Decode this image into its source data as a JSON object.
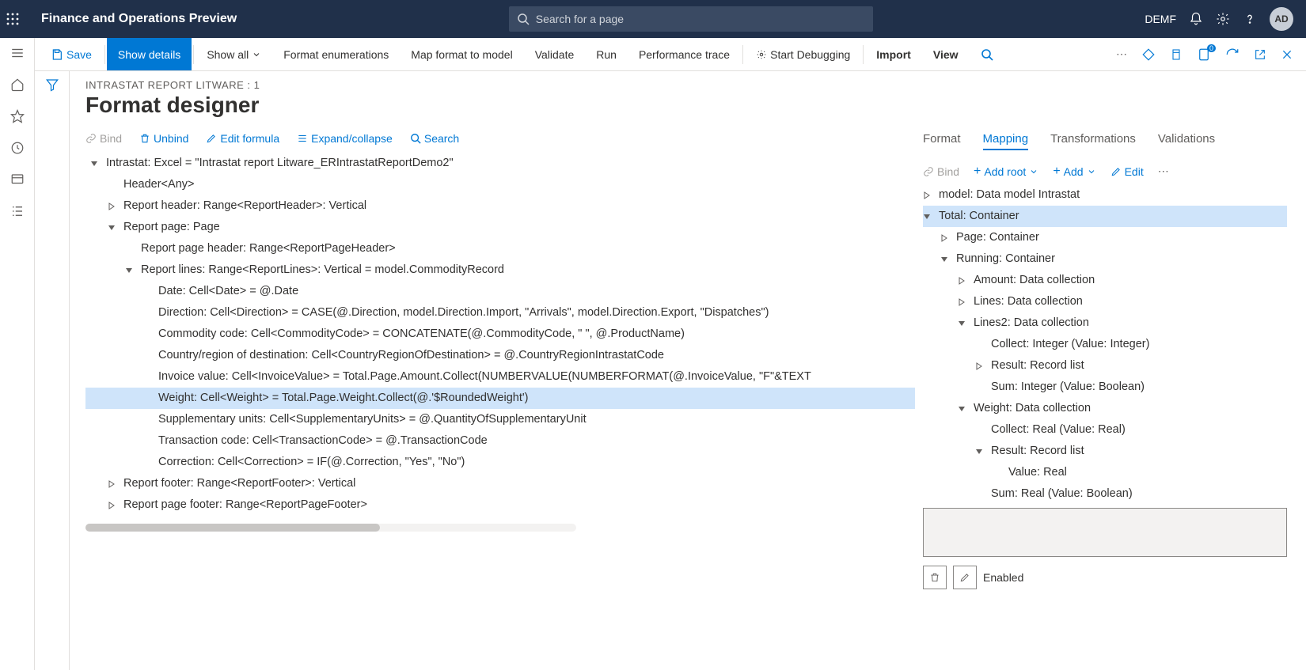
{
  "topbar": {
    "title": "Finance and Operations Preview",
    "search_placeholder": "Search for a page",
    "company": "DEMF",
    "avatar": "AD"
  },
  "cmdbar": {
    "save": "Save",
    "show_details": "Show details",
    "show_all": "Show all",
    "format_enum": "Format enumerations",
    "map_format": "Map format to model",
    "validate": "Validate",
    "run": "Run",
    "perf": "Performance trace",
    "debug": "Start Debugging",
    "import": "Import",
    "view": "View"
  },
  "page": {
    "breadcrumb": "INTRASTAT REPORT LITWARE : 1",
    "title": "Format designer"
  },
  "left_toolbar": {
    "bind": "Bind",
    "unbind": "Unbind",
    "edit_formula": "Edit formula",
    "expand": "Expand/collapse",
    "search": "Search"
  },
  "left_tree": [
    {
      "indent": 0,
      "caret": "down",
      "text": "Intrastat: Excel = \"Intrastat report Litware_ERIntrastatReportDemo2\""
    },
    {
      "indent": 1,
      "caret": "",
      "text": "Header<Any>"
    },
    {
      "indent": 1,
      "caret": "right",
      "text": "Report header: Range<ReportHeader>: Vertical"
    },
    {
      "indent": 1,
      "caret": "down",
      "text": "Report page: Page"
    },
    {
      "indent": 2,
      "caret": "",
      "text": "Report page header: Range<ReportPageHeader>"
    },
    {
      "indent": 2,
      "caret": "down",
      "text": "Report lines: Range<ReportLines>: Vertical = model.CommodityRecord"
    },
    {
      "indent": 3,
      "caret": "",
      "text": "Date: Cell<Date> = @.Date"
    },
    {
      "indent": 3,
      "caret": "",
      "text": "Direction: Cell<Direction> = CASE(@.Direction, model.Direction.Import, \"Arrivals\", model.Direction.Export, \"Dispatches\")"
    },
    {
      "indent": 3,
      "caret": "",
      "text": "Commodity code: Cell<CommodityCode> = CONCATENATE(@.CommodityCode, \" \", @.ProductName)"
    },
    {
      "indent": 3,
      "caret": "",
      "text": "Country/region of destination: Cell<CountryRegionOfDestination> = @.CountryRegionIntrastatCode"
    },
    {
      "indent": 3,
      "caret": "",
      "text": "Invoice value: Cell<InvoiceValue> = Total.Page.Amount.Collect(NUMBERVALUE(NUMBERFORMAT(@.InvoiceValue, \"F\"&TEXT"
    },
    {
      "indent": 3,
      "caret": "",
      "text": "Weight: Cell<Weight> = Total.Page.Weight.Collect(@.'$RoundedWeight')",
      "selected": true
    },
    {
      "indent": 3,
      "caret": "",
      "text": "Supplementary units: Cell<SupplementaryUnits> = @.QuantityOfSupplementaryUnit"
    },
    {
      "indent": 3,
      "caret": "",
      "text": "Transaction code: Cell<TransactionCode> = @.TransactionCode"
    },
    {
      "indent": 3,
      "caret": "",
      "text": "Correction: Cell<Correction> = IF(@.Correction, \"Yes\", \"No\")"
    },
    {
      "indent": 1,
      "caret": "right",
      "text": "Report footer: Range<ReportFooter>: Vertical"
    },
    {
      "indent": 1,
      "caret": "right",
      "text": "Report page footer: Range<ReportPageFooter>"
    }
  ],
  "right_tabs": {
    "format": "Format",
    "mapping": "Mapping",
    "transformations": "Transformations",
    "validations": "Validations"
  },
  "right_toolbar": {
    "bind": "Bind",
    "add_root": "Add root",
    "add": "Add",
    "edit": "Edit"
  },
  "right_tree": [
    {
      "indent": 0,
      "caret": "right",
      "text": "model: Data model Intrastat"
    },
    {
      "indent": 0,
      "caret": "down",
      "text": "Total: Container",
      "selected": true
    },
    {
      "indent": 1,
      "caret": "right",
      "text": "Page: Container"
    },
    {
      "indent": 1,
      "caret": "down",
      "text": "Running: Container"
    },
    {
      "indent": 2,
      "caret": "right",
      "text": "Amount: Data collection"
    },
    {
      "indent": 2,
      "caret": "right",
      "text": "Lines: Data collection"
    },
    {
      "indent": 2,
      "caret": "down",
      "text": "Lines2: Data collection"
    },
    {
      "indent": 3,
      "caret": "",
      "text": "Collect: Integer (Value: Integer)"
    },
    {
      "indent": 3,
      "caret": "right",
      "text": "Result: Record list"
    },
    {
      "indent": 3,
      "caret": "",
      "text": "Sum: Integer (Value: Boolean)"
    },
    {
      "indent": 2,
      "caret": "down",
      "text": "Weight: Data collection"
    },
    {
      "indent": 3,
      "caret": "",
      "text": "Collect: Real (Value: Real)"
    },
    {
      "indent": 3,
      "caret": "down",
      "text": "Result: Record list"
    },
    {
      "indent": 4,
      "caret": "",
      "text": "Value: Real"
    },
    {
      "indent": 3,
      "caret": "",
      "text": "Sum: Real (Value: Boolean)"
    }
  ],
  "prop": {
    "enabled": "Enabled"
  }
}
